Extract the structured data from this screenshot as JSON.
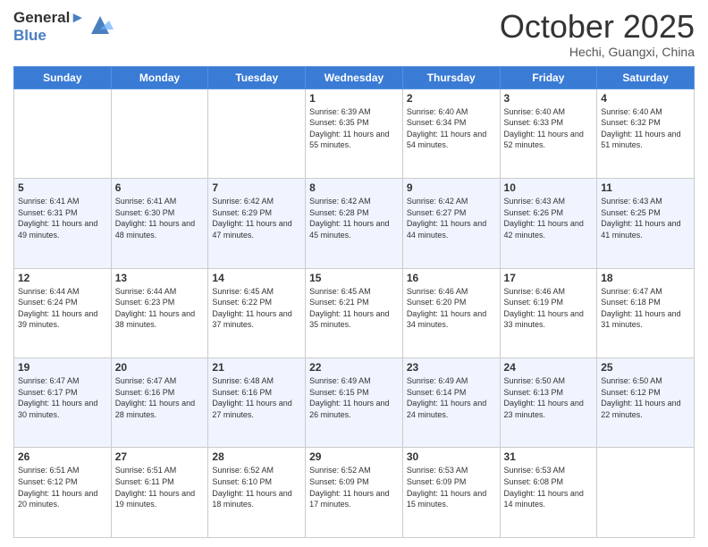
{
  "header": {
    "logo_general": "General",
    "logo_blue": "Blue",
    "month": "October 2025",
    "location": "Hechi, Guangxi, China"
  },
  "days_of_week": [
    "Sunday",
    "Monday",
    "Tuesday",
    "Wednesday",
    "Thursday",
    "Friday",
    "Saturday"
  ],
  "weeks": [
    [
      {
        "day": "",
        "sunrise": "",
        "sunset": "",
        "daylight": ""
      },
      {
        "day": "",
        "sunrise": "",
        "sunset": "",
        "daylight": ""
      },
      {
        "day": "",
        "sunrise": "",
        "sunset": "",
        "daylight": ""
      },
      {
        "day": "1",
        "sunrise": "Sunrise: 6:39 AM",
        "sunset": "Sunset: 6:35 PM",
        "daylight": "Daylight: 11 hours and 55 minutes."
      },
      {
        "day": "2",
        "sunrise": "Sunrise: 6:40 AM",
        "sunset": "Sunset: 6:34 PM",
        "daylight": "Daylight: 11 hours and 54 minutes."
      },
      {
        "day": "3",
        "sunrise": "Sunrise: 6:40 AM",
        "sunset": "Sunset: 6:33 PM",
        "daylight": "Daylight: 11 hours and 52 minutes."
      },
      {
        "day": "4",
        "sunrise": "Sunrise: 6:40 AM",
        "sunset": "Sunset: 6:32 PM",
        "daylight": "Daylight: 11 hours and 51 minutes."
      }
    ],
    [
      {
        "day": "5",
        "sunrise": "Sunrise: 6:41 AM",
        "sunset": "Sunset: 6:31 PM",
        "daylight": "Daylight: 11 hours and 49 minutes."
      },
      {
        "day": "6",
        "sunrise": "Sunrise: 6:41 AM",
        "sunset": "Sunset: 6:30 PM",
        "daylight": "Daylight: 11 hours and 48 minutes."
      },
      {
        "day": "7",
        "sunrise": "Sunrise: 6:42 AM",
        "sunset": "Sunset: 6:29 PM",
        "daylight": "Daylight: 11 hours and 47 minutes."
      },
      {
        "day": "8",
        "sunrise": "Sunrise: 6:42 AM",
        "sunset": "Sunset: 6:28 PM",
        "daylight": "Daylight: 11 hours and 45 minutes."
      },
      {
        "day": "9",
        "sunrise": "Sunrise: 6:42 AM",
        "sunset": "Sunset: 6:27 PM",
        "daylight": "Daylight: 11 hours and 44 minutes."
      },
      {
        "day": "10",
        "sunrise": "Sunrise: 6:43 AM",
        "sunset": "Sunset: 6:26 PM",
        "daylight": "Daylight: 11 hours and 42 minutes."
      },
      {
        "day": "11",
        "sunrise": "Sunrise: 6:43 AM",
        "sunset": "Sunset: 6:25 PM",
        "daylight": "Daylight: 11 hours and 41 minutes."
      }
    ],
    [
      {
        "day": "12",
        "sunrise": "Sunrise: 6:44 AM",
        "sunset": "Sunset: 6:24 PM",
        "daylight": "Daylight: 11 hours and 39 minutes."
      },
      {
        "day": "13",
        "sunrise": "Sunrise: 6:44 AM",
        "sunset": "Sunset: 6:23 PM",
        "daylight": "Daylight: 11 hours and 38 minutes."
      },
      {
        "day": "14",
        "sunrise": "Sunrise: 6:45 AM",
        "sunset": "Sunset: 6:22 PM",
        "daylight": "Daylight: 11 hours and 37 minutes."
      },
      {
        "day": "15",
        "sunrise": "Sunrise: 6:45 AM",
        "sunset": "Sunset: 6:21 PM",
        "daylight": "Daylight: 11 hours and 35 minutes."
      },
      {
        "day": "16",
        "sunrise": "Sunrise: 6:46 AM",
        "sunset": "Sunset: 6:20 PM",
        "daylight": "Daylight: 11 hours and 34 minutes."
      },
      {
        "day": "17",
        "sunrise": "Sunrise: 6:46 AM",
        "sunset": "Sunset: 6:19 PM",
        "daylight": "Daylight: 11 hours and 33 minutes."
      },
      {
        "day": "18",
        "sunrise": "Sunrise: 6:47 AM",
        "sunset": "Sunset: 6:18 PM",
        "daylight": "Daylight: 11 hours and 31 minutes."
      }
    ],
    [
      {
        "day": "19",
        "sunrise": "Sunrise: 6:47 AM",
        "sunset": "Sunset: 6:17 PM",
        "daylight": "Daylight: 11 hours and 30 minutes."
      },
      {
        "day": "20",
        "sunrise": "Sunrise: 6:47 AM",
        "sunset": "Sunset: 6:16 PM",
        "daylight": "Daylight: 11 hours and 28 minutes."
      },
      {
        "day": "21",
        "sunrise": "Sunrise: 6:48 AM",
        "sunset": "Sunset: 6:16 PM",
        "daylight": "Daylight: 11 hours and 27 minutes."
      },
      {
        "day": "22",
        "sunrise": "Sunrise: 6:49 AM",
        "sunset": "Sunset: 6:15 PM",
        "daylight": "Daylight: 11 hours and 26 minutes."
      },
      {
        "day": "23",
        "sunrise": "Sunrise: 6:49 AM",
        "sunset": "Sunset: 6:14 PM",
        "daylight": "Daylight: 11 hours and 24 minutes."
      },
      {
        "day": "24",
        "sunrise": "Sunrise: 6:50 AM",
        "sunset": "Sunset: 6:13 PM",
        "daylight": "Daylight: 11 hours and 23 minutes."
      },
      {
        "day": "25",
        "sunrise": "Sunrise: 6:50 AM",
        "sunset": "Sunset: 6:12 PM",
        "daylight": "Daylight: 11 hours and 22 minutes."
      }
    ],
    [
      {
        "day": "26",
        "sunrise": "Sunrise: 6:51 AM",
        "sunset": "Sunset: 6:12 PM",
        "daylight": "Daylight: 11 hours and 20 minutes."
      },
      {
        "day": "27",
        "sunrise": "Sunrise: 6:51 AM",
        "sunset": "Sunset: 6:11 PM",
        "daylight": "Daylight: 11 hours and 19 minutes."
      },
      {
        "day": "28",
        "sunrise": "Sunrise: 6:52 AM",
        "sunset": "Sunset: 6:10 PM",
        "daylight": "Daylight: 11 hours and 18 minutes."
      },
      {
        "day": "29",
        "sunrise": "Sunrise: 6:52 AM",
        "sunset": "Sunset: 6:09 PM",
        "daylight": "Daylight: 11 hours and 17 minutes."
      },
      {
        "day": "30",
        "sunrise": "Sunrise: 6:53 AM",
        "sunset": "Sunset: 6:09 PM",
        "daylight": "Daylight: 11 hours and 15 minutes."
      },
      {
        "day": "31",
        "sunrise": "Sunrise: 6:53 AM",
        "sunset": "Sunset: 6:08 PM",
        "daylight": "Daylight: 11 hours and 14 minutes."
      },
      {
        "day": "",
        "sunrise": "",
        "sunset": "",
        "daylight": ""
      }
    ]
  ]
}
